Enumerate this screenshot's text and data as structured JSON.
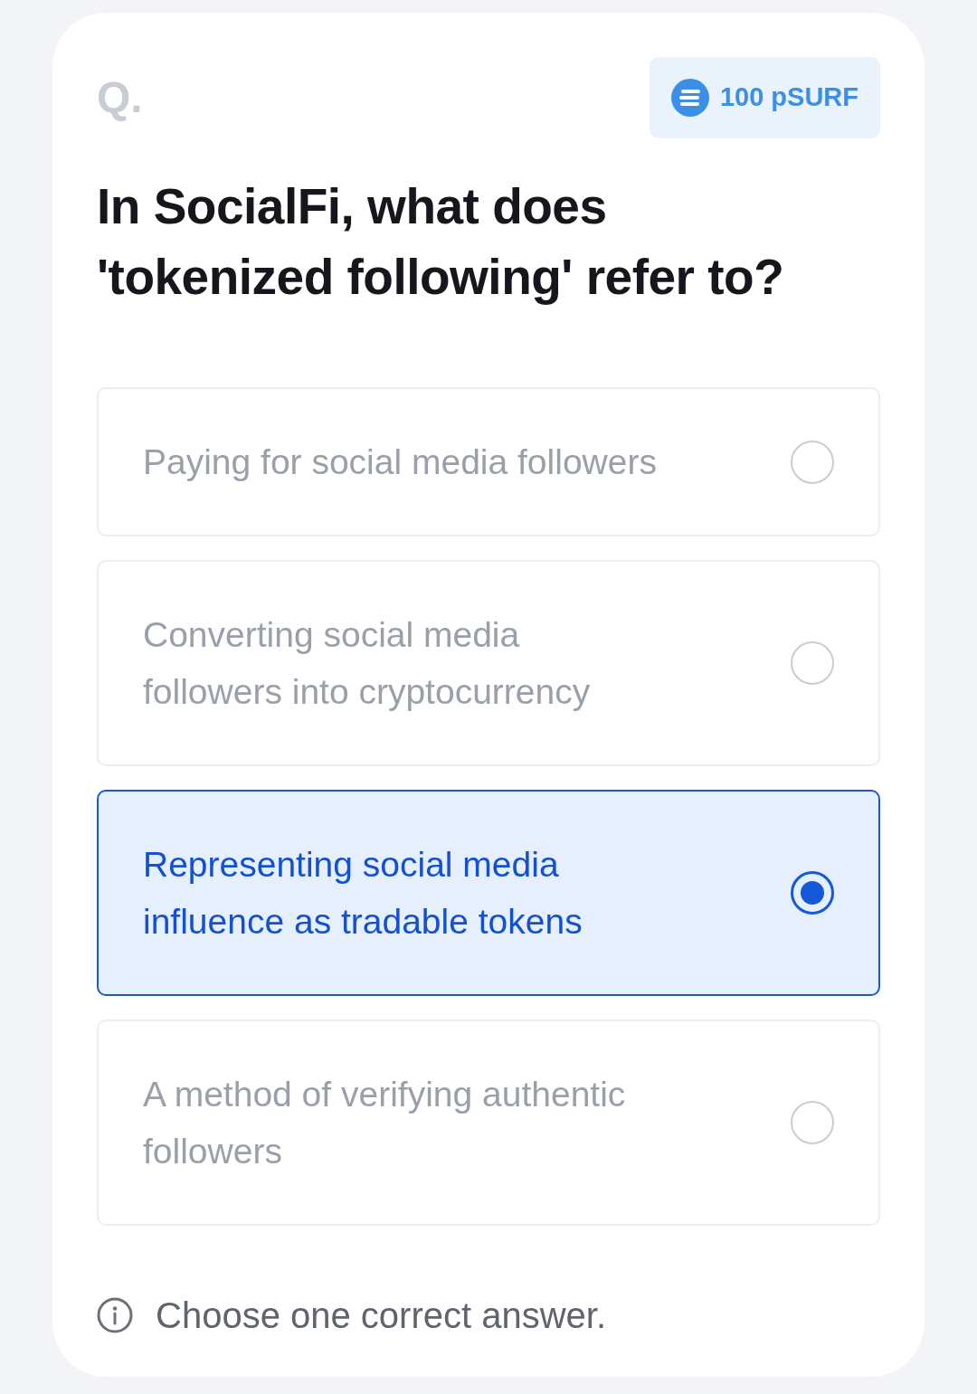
{
  "question": {
    "marker": "Q.",
    "reward": "100 pSURF",
    "lines": [
      "In SocialFi, what does",
      "'tokenized following' refer to?"
    ]
  },
  "options": [
    {
      "lines": [
        "Paying for social media followers"
      ],
      "selected": false
    },
    {
      "lines": [
        "Converting social media",
        "followers into cryptocurrency"
      ],
      "selected": false
    },
    {
      "lines": [
        "Representing social media",
        "influence as tradable tokens"
      ],
      "selected": true
    },
    {
      "lines": [
        "A method of verifying authentic",
        "followers"
      ],
      "selected": false
    }
  ],
  "hint": "Choose one correct answer."
}
